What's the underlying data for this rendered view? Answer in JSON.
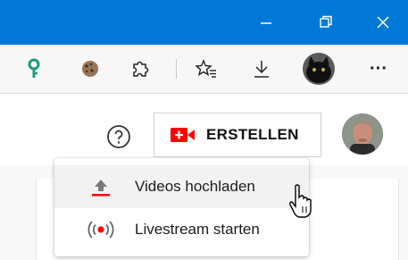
{
  "window": {
    "controls": [
      {
        "name": "minimize",
        "glyph": "—"
      },
      {
        "name": "restore",
        "glyph": "restore"
      },
      {
        "name": "close",
        "glyph": "✕"
      }
    ]
  },
  "toolbar": {
    "icons": [
      "key-icon",
      "cookie-icon",
      "extensions-icon",
      "favorites-icon",
      "downloads-icon",
      "profile-avatar",
      "more-icon"
    ],
    "more_label": "···"
  },
  "header": {
    "help_icon": "help-circle-icon",
    "create_label": "ERSTELLEN",
    "accent_color": "#ff0000"
  },
  "create_menu": {
    "items": [
      {
        "label": "Videos hochladen",
        "icon": "upload-icon",
        "active": true
      },
      {
        "label": "Livestream starten",
        "icon": "live-broadcast-icon",
        "active": false
      }
    ]
  }
}
